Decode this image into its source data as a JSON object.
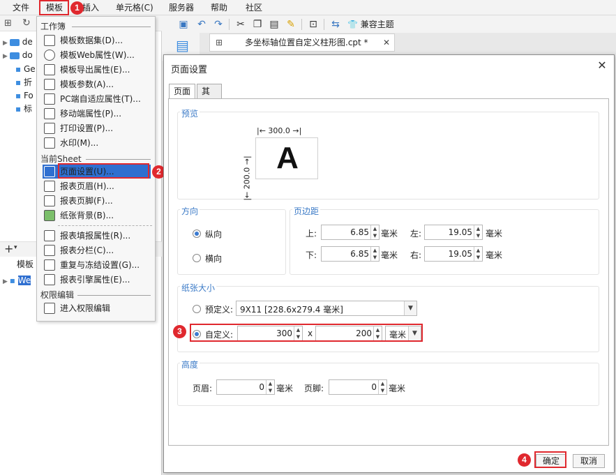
{
  "menubar": {
    "items": [
      "文件",
      "模板",
      "插入",
      "单元格(C)",
      "服务器",
      "帮助",
      "社区"
    ]
  },
  "steps": [
    "1",
    "2",
    "3",
    "4"
  ],
  "toolbar": {
    "theme_label": "兼容主题"
  },
  "file_tab": {
    "label": "多坐标轴位置自定义柱形图.cpt *"
  },
  "left_panel": {
    "tree": [
      "de",
      "do",
      "Ge",
      "折",
      "Fo",
      "标"
    ],
    "bottom_tab": "模板",
    "bottom_tree": "We"
  },
  "menu": {
    "section_workbook": "工作簿",
    "section_sheet": "当前Sheet",
    "section_permission": "权限编辑",
    "workbook_items": [
      "模板数据集(D)...",
      "模板Web属性(W)...",
      "模板导出属性(E)...",
      "模板参数(A)...",
      "PC端自适应属性(T)...",
      "移动端属性(P)...",
      "打印设置(P)...",
      "水印(M)..."
    ],
    "sheet_items": [
      "页面设置(U)...",
      "报表页眉(H)...",
      "报表页脚(F)...",
      "纸张背景(B)..."
    ],
    "sheet_items2": [
      "报表填报属性(R)...",
      "报表分栏(C)...",
      "重复与冻结设置(G)...",
      "报表引擎属性(E)..."
    ],
    "permission_items": [
      "进入权限编辑"
    ]
  },
  "dialog": {
    "title": "页面设置",
    "tabs": [
      "页面",
      "其他"
    ],
    "preview": {
      "title": "预览",
      "width_label": "300.0",
      "height_label": "200.0",
      "letter": "A"
    },
    "orientation": {
      "title": "方向",
      "portrait": "纵向",
      "landscape": "横向",
      "selected": "纵向"
    },
    "margins": {
      "title": "页边距",
      "top_label": "上:",
      "top_value": "6.85",
      "bottom_label": "下:",
      "bottom_value": "6.85",
      "left_label": "左:",
      "left_value": "19.05",
      "right_label": "右:",
      "right_value": "19.05",
      "unit": "毫米"
    },
    "paper": {
      "title": "纸张大小",
      "preset_label": "预定义:",
      "preset_value": "9X11 [228.6x279.4 毫米]",
      "custom_label": "自定义:",
      "custom_width": "300",
      "x_label": "x",
      "custom_height": "200",
      "unit_value": "毫米"
    },
    "height": {
      "title": "高度",
      "header_label": "页眉:",
      "header_value": "0",
      "footer_label": "页脚:",
      "footer_value": "0",
      "unit": "毫米"
    },
    "ok_label": "确定",
    "cancel_label": "取消"
  },
  "colors": {
    "accent": "#3c7bc7",
    "highlight": "#e0282e",
    "menu_selected": "#2f6fd0"
  }
}
